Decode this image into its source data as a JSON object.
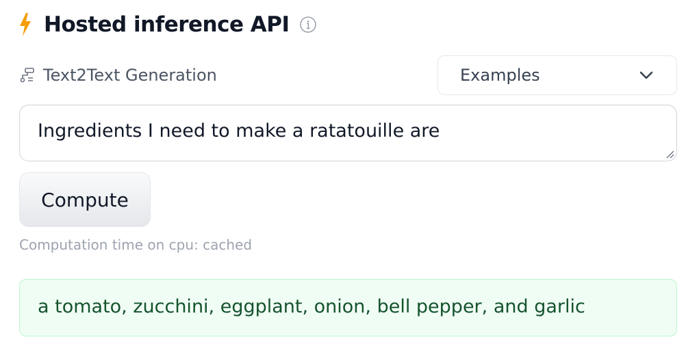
{
  "header": {
    "title": "Hosted inference API",
    "bolt_icon": "lightning-bolt-icon",
    "info_icon": "info-icon",
    "bolt_color": "#f59e0b"
  },
  "task": {
    "icon": "text2text-task-icon",
    "label": "Text2Text Generation"
  },
  "examples": {
    "label": "Examples",
    "icon": "chevron-down-icon"
  },
  "input": {
    "value": "Ingredients I need to make a ratatouille are"
  },
  "compute": {
    "label": "Compute"
  },
  "status": {
    "computation_time": "Computation time on cpu: cached"
  },
  "output": {
    "text": "a tomato, zucchini, eggplant, onion, bell pepper, and garlic",
    "background_color": "#f0fdf4",
    "text_color": "#14532d"
  }
}
